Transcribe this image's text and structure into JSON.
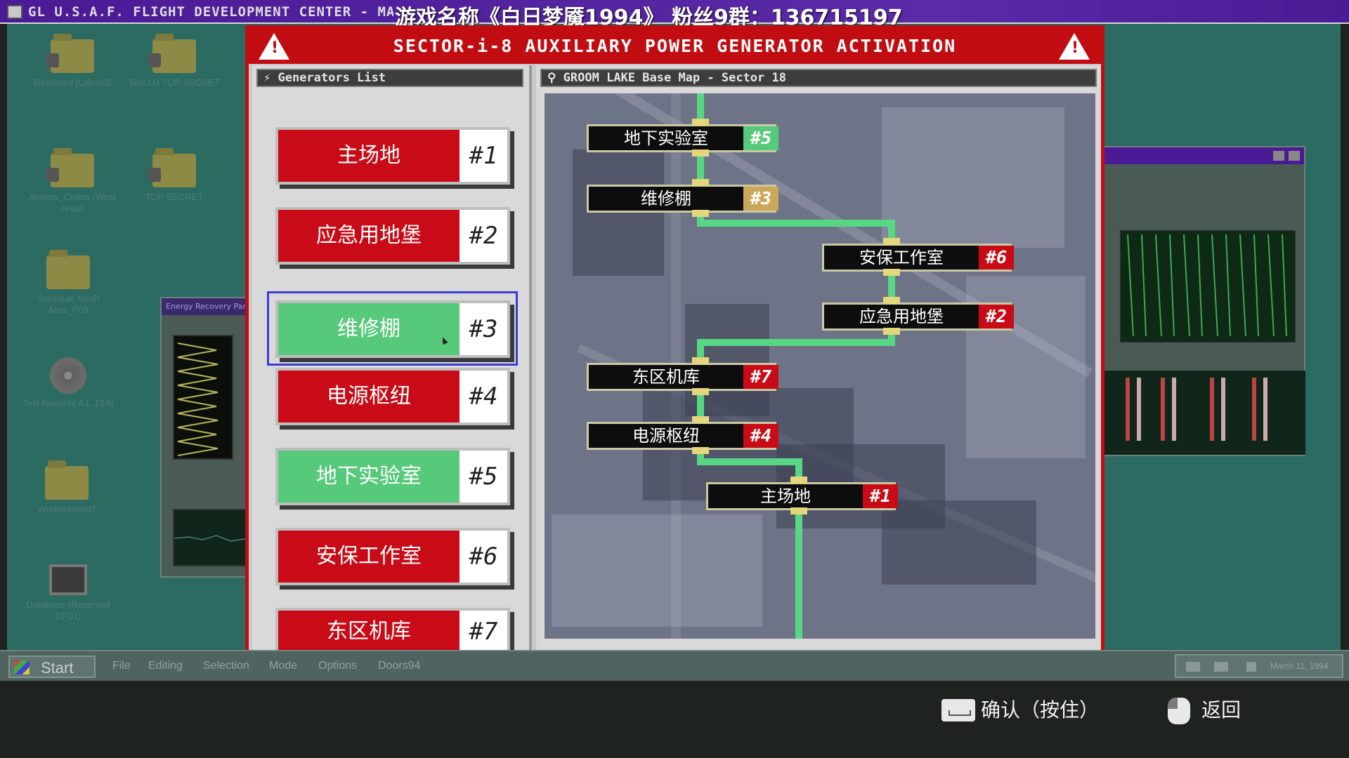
{
  "window_title": "GL U.S.A.F. FLIGHT DEVELOPMENT CENTER - MAINFRA",
  "overlay_caption": "游戏名称《白日梦魇1994》 粉丝9群：136715197",
  "desktop_icons": [
    {
      "label": "Reserved [Labo03]"
    },
    {
      "label": "Test LH TOP SECRET"
    },
    {
      "label": "Access_Codes (West Area)"
    },
    {
      "label": "TOP SECRET"
    },
    {
      "label": "Schedule North Area_P08"
    },
    {
      "label": "Test Records A.L.13-N"
    },
    {
      "label": "Workstation07"
    },
    {
      "label": "Database (Reserved DP01)"
    }
  ],
  "bg_window_left_title": "Energy Recovery Par",
  "dialog": {
    "title": "SECTOR-i-8 AUXILIARY POWER GENERATOR ACTIVATION",
    "warning_glyph": "!"
  },
  "generators_panel": {
    "header": "⚡ Generators List",
    "items": [
      {
        "name": "主场地",
        "number": "#1",
        "state": "red"
      },
      {
        "name": "应急用地堡",
        "number": "#2",
        "state": "red"
      },
      {
        "name": "维修棚",
        "number": "#3",
        "state": "green",
        "selected": true
      },
      {
        "name": "电源枢纽",
        "number": "#4",
        "state": "red"
      },
      {
        "name": "地下实验室",
        "number": "#5",
        "state": "green"
      },
      {
        "name": "安保工作室",
        "number": "#6",
        "state": "red"
      },
      {
        "name": "东区机库",
        "number": "#7",
        "state": "red"
      }
    ]
  },
  "map_panel": {
    "header": "⚲ GROOM LAKE Base Map - Sector 18",
    "nodes": [
      {
        "name": "地下实验室",
        "number": "#5",
        "color": "green"
      },
      {
        "name": "维修棚",
        "number": "#3",
        "color": "tan"
      },
      {
        "name": "安保工作室",
        "number": "#6",
        "color": "red"
      },
      {
        "name": "应急用地堡",
        "number": "#2",
        "color": "red"
      },
      {
        "name": "东区机库",
        "number": "#7",
        "color": "red"
      },
      {
        "name": "电源枢纽",
        "number": "#4",
        "color": "red"
      },
      {
        "name": "主场地",
        "number": "#1",
        "color": "red"
      }
    ]
  },
  "taskbar": {
    "start_label": "Start",
    "menus": [
      "File",
      "Editing",
      "Selection",
      "Mode",
      "Options",
      "Doors94"
    ],
    "date": "March 11, 1994"
  },
  "hints": {
    "confirm": "确认（按住）",
    "back": "返回"
  },
  "colors": {
    "active_green": "#57c97a",
    "inactive_red": "#c80b16",
    "route_green": "#57d784",
    "dialog_red": "#c10d12",
    "title_purple": "#4b1a95"
  }
}
